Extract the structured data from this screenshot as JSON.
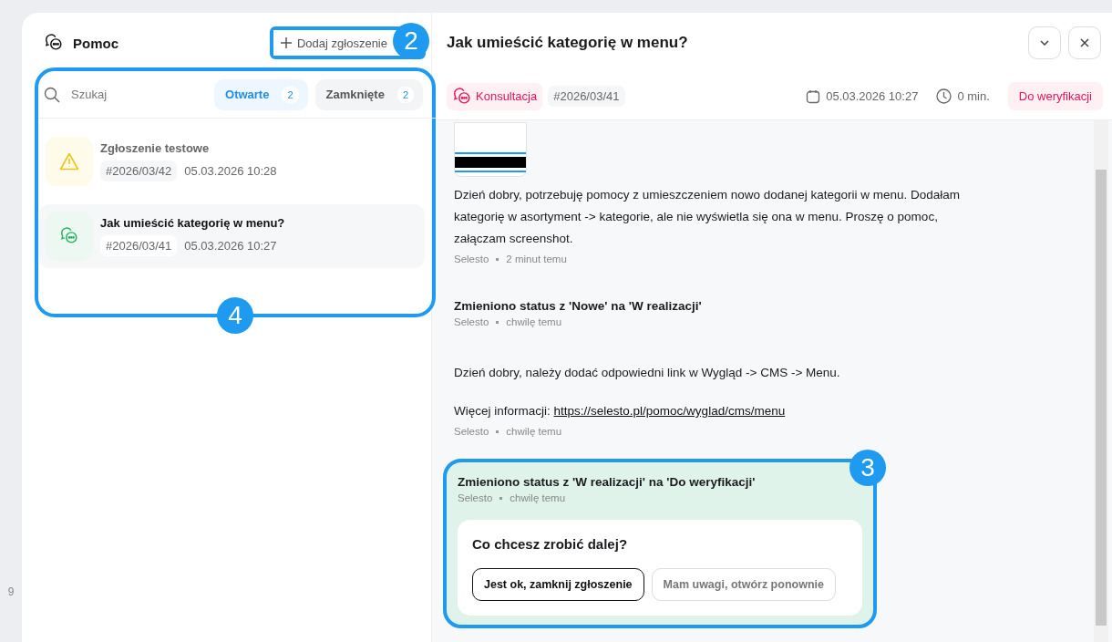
{
  "background": {
    "axis_label": "9"
  },
  "sidebar": {
    "title": "Pomoc",
    "add_button": {
      "label": "Dodaj zgłoszenie",
      "callout": "2"
    },
    "callout": "4",
    "search": {
      "placeholder": "Szukaj"
    },
    "tabs": [
      {
        "label": "Otwarte",
        "count": "2",
        "selected": true
      },
      {
        "label": "Zamknięte",
        "count": "2",
        "selected": false
      }
    ],
    "tickets": [
      {
        "kind": "warning",
        "title": "Zgłoszenie testowe",
        "number": "#2026/03/42",
        "date": "05.03.2026 10:28",
        "selected": false
      },
      {
        "kind": "chat",
        "title": "Jak umieścić kategorię w menu?",
        "number": "#2026/03/41",
        "date": "05.03.2026 10:27",
        "selected": true
      }
    ]
  },
  "detail": {
    "title": "Jak umieścić kategorię w menu?",
    "category": "Konsultacja",
    "number": "#2026/03/41",
    "date": "05.03.2026 10:27",
    "duration": "0 min.",
    "status": "Do weryfikacji",
    "messages": [
      {
        "kind": "message",
        "attachment": true,
        "body": "Dzień dobry, potrzebuję pomocy z umieszczeniem nowo dodanej kategorii w menu. Dodałam kategorię w asortyment -> kategorie, ale nie wyświetla się ona w menu. Proszę o pomoc, załączam screenshot.",
        "author": "Selesto",
        "time": "2 minut temu"
      },
      {
        "kind": "status",
        "body": "Zmieniono status z 'Nowe' na 'W realizacji'",
        "author": "Selesto",
        "time": "chwilę temu"
      },
      {
        "kind": "message",
        "body": "Dzień dobry, należy dodać odpowiedni link w Wygląd -> CMS -> Menu.",
        "more_label": "Więcej informacji:",
        "link": "https://selesto.pl/pomoc/wyglad/cms/menu",
        "author": "Selesto",
        "time": "chwilę temu"
      },
      {
        "kind": "status",
        "highlighted": true,
        "callout": "3",
        "body": "Zmieniono status z 'W realizacji' na 'Do weryfikacji'",
        "author": "Selesto",
        "time": "chwilę temu",
        "prompt": {
          "question": "Co chcesz zrobić dalej?",
          "buttons": [
            {
              "label": "Jest ok, zamknij zgłoszenie",
              "kind": "primary"
            },
            {
              "label": "Mam uwagi, otwórz ponownie",
              "kind": "secondary"
            }
          ]
        }
      }
    ]
  }
}
